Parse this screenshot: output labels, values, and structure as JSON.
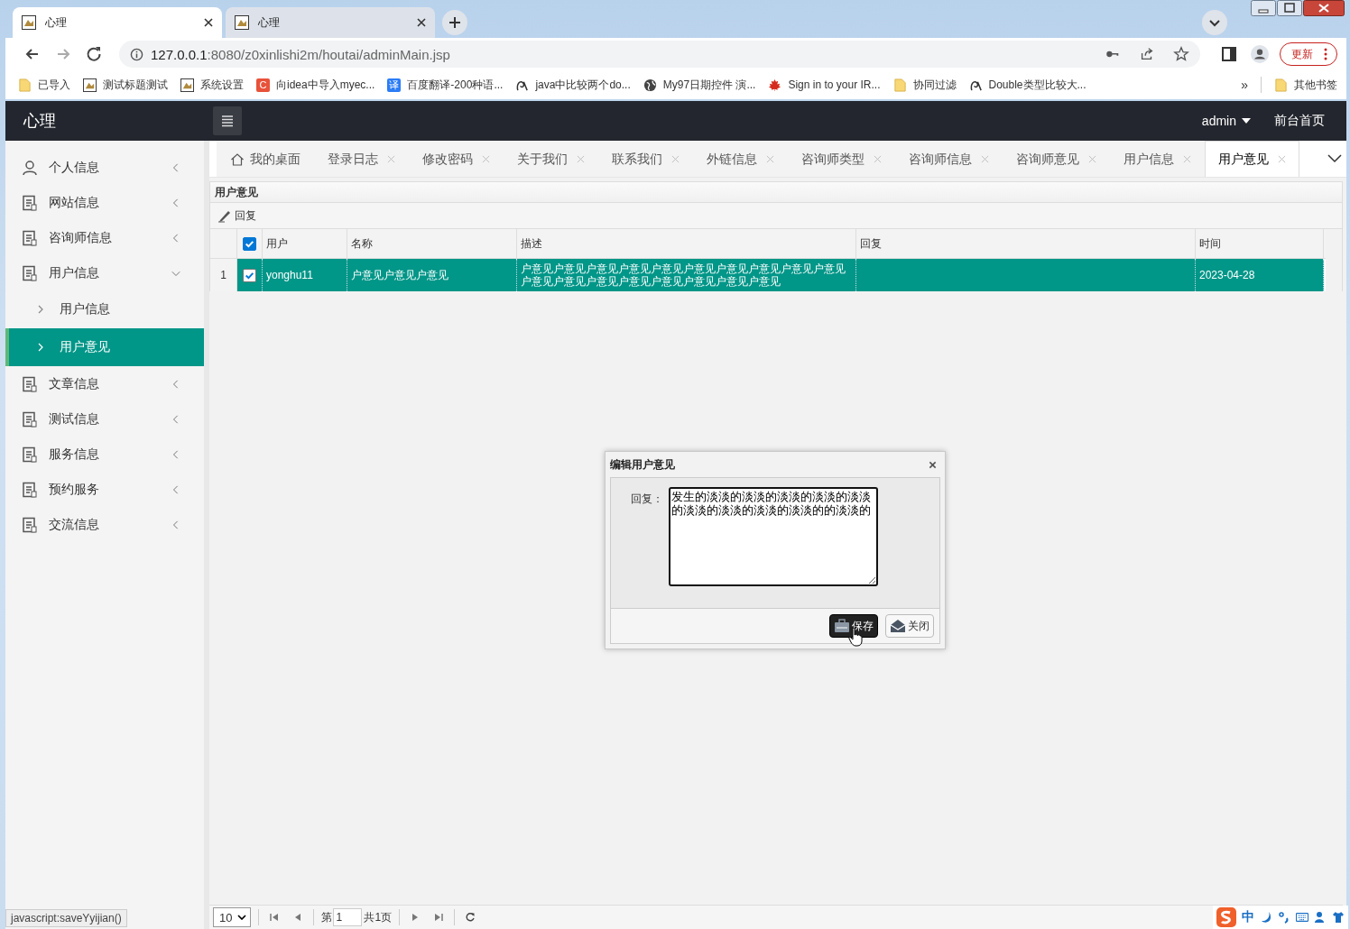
{
  "browser": {
    "tabs": [
      {
        "title": "心理",
        "selected": true
      },
      {
        "title": "心理",
        "selected": false
      }
    ],
    "url_host": "127.0.0.1",
    "url_rest": ":8080/z0xinlishi2m/houtai/adminMain.jsp",
    "update_button": "更新",
    "bookmarks": [
      {
        "label": "已导入",
        "kind": "folder"
      },
      {
        "label": "测试标题测试",
        "kind": "page"
      },
      {
        "label": "系统设置",
        "kind": "page"
      },
      {
        "label": "向idea中导入myec...",
        "kind": "letter",
        "glyph": "C",
        "color": "#e8523a"
      },
      {
        "label": "百度翻译-200种语...",
        "kind": "letter",
        "glyph": "译",
        "color": "#2b7cf6"
      },
      {
        "label": "java中比较两个do...",
        "kind": "swirl"
      },
      {
        "label": "My97日期控件 演...",
        "kind": "globe"
      },
      {
        "label": "Sign in to your IR...",
        "kind": "leaf"
      },
      {
        "label": "协同过滤",
        "kind": "folder"
      },
      {
        "label": "Double类型比较大...",
        "kind": "swirl"
      }
    ],
    "more": "»",
    "other_bookmarks": "其他书签"
  },
  "app": {
    "title": "心理",
    "user": "admin",
    "front_link": "前台首页"
  },
  "sidebar": [
    {
      "label": "个人信息",
      "kind": "person",
      "expanded": false
    },
    {
      "label": "网站信息",
      "kind": "doc",
      "expanded": false
    },
    {
      "label": "咨询师信息",
      "kind": "doc",
      "expanded": false
    },
    {
      "label": "用户信息",
      "kind": "doc",
      "expanded": true,
      "children": [
        {
          "label": "用户信息",
          "selected": false
        },
        {
          "label": "用户意见",
          "selected": true
        }
      ]
    },
    {
      "label": "文章信息",
      "kind": "doc",
      "expanded": false
    },
    {
      "label": "测试信息",
      "kind": "doc",
      "expanded": false
    },
    {
      "label": "服务信息",
      "kind": "doc",
      "expanded": false
    },
    {
      "label": "预约服务",
      "kind": "doc",
      "expanded": false
    },
    {
      "label": "交流信息",
      "kind": "doc",
      "expanded": false
    }
  ],
  "tabs": [
    {
      "label": "我的桌面",
      "kind": "home",
      "selected": false
    },
    {
      "label": "登录日志",
      "kind": "closable",
      "selected": false
    },
    {
      "label": "修改密码",
      "kind": "closable",
      "selected": false
    },
    {
      "label": "关于我们",
      "kind": "closable",
      "selected": false
    },
    {
      "label": "联系我们",
      "kind": "closable",
      "selected": false
    },
    {
      "label": "外链信息",
      "kind": "closable",
      "selected": false
    },
    {
      "label": "咨询师类型",
      "kind": "closable",
      "selected": false
    },
    {
      "label": "咨询师信息",
      "kind": "closable",
      "selected": false
    },
    {
      "label": "咨询师意见",
      "kind": "closable",
      "selected": false
    },
    {
      "label": "用户信息",
      "kind": "closable",
      "selected": false
    },
    {
      "label": "用户意见",
      "kind": "closable",
      "selected": true
    }
  ],
  "panel": {
    "title": "用户意见",
    "toolbar_button": "回复",
    "header_checked": true,
    "columns": [
      "用户",
      "名称",
      "描述",
      "回复",
      "时间"
    ],
    "rows": [
      {
        "number": "1",
        "checked": true,
        "selected": true,
        "cells": [
          "yonghu11",
          "户意见户意见户意见",
          "户意见户意见户意见户意见户意见户意见户意见户意见户意见户意见户意见户意见户意见户意见户意见户意见户意见户意见",
          "",
          "2023-04-28"
        ]
      }
    ]
  },
  "dialog": {
    "title": "编辑用户意见",
    "field_label": "回复：",
    "value": "发生的淡淡的淡淡的淡淡的淡淡的淡淡的淡淡的淡淡的淡淡的淡淡的的淡淡的",
    "buttons": [
      {
        "label": "保存",
        "kind": "save",
        "selected": true
      },
      {
        "label": "关闭",
        "kind": "close",
        "selected": false
      }
    ]
  },
  "pager": {
    "page_size": "10",
    "before": "第",
    "page": "1",
    "total": "共1页"
  },
  "status_text": "javascript:saveYyijian()",
  "ime": {
    "label": "中"
  }
}
